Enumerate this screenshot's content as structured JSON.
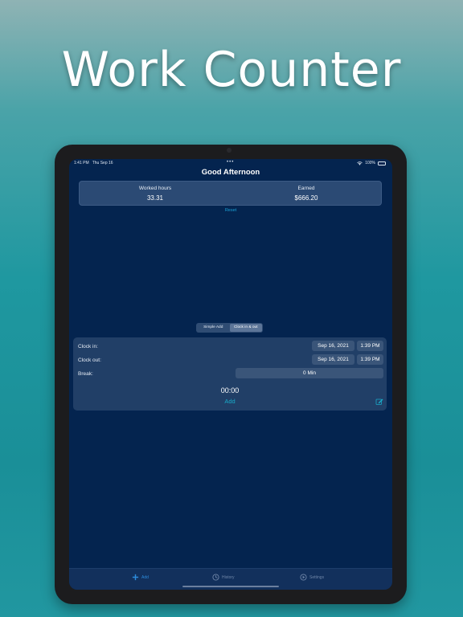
{
  "headline": "Work Counter",
  "status": {
    "time": "1:41 PM",
    "date": "Thu Sep 16",
    "dots": "•••",
    "battery": "100%"
  },
  "greeting": "Good Afternoon",
  "stats": {
    "hours_label": "Worked hours",
    "hours_value": "33.31",
    "earned_label": "Earned",
    "earned_value": "$666.20"
  },
  "reset_label": "Reset",
  "segments": {
    "simple": "Simple Add",
    "clock": "Clock in & out",
    "selected": "Clock in & out"
  },
  "clock": {
    "in_label": "Clock in:",
    "in_date": "Sep 16, 2021",
    "in_time": "1:39 PM",
    "out_label": "Clock out:",
    "out_date": "Sep 16, 2021",
    "out_time": "1:39 PM",
    "break_label": "Break:",
    "break_value": "0 Min",
    "timer": "00:00",
    "add_label": "Add"
  },
  "tabs": {
    "add": "Add",
    "history": "History",
    "settings": "Settings",
    "active": "add"
  },
  "colors": {
    "screen_bg": "#04244f",
    "accent": "#19a9c7",
    "tab_active": "#2c8bdc"
  }
}
